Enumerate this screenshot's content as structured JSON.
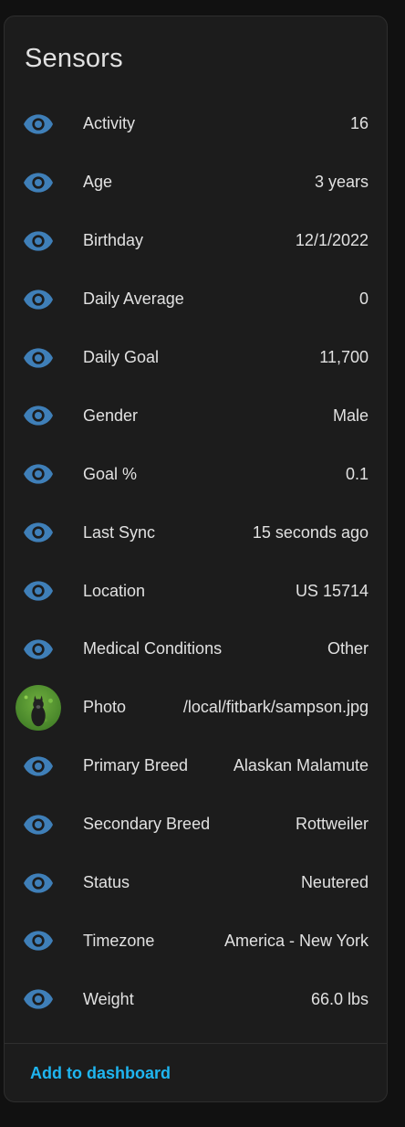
{
  "card": {
    "title": "Sensors",
    "footer_action": "Add to dashboard"
  },
  "colors": {
    "background": "#111111",
    "card": "#1c1c1c",
    "text": "#e1e1e1",
    "icon": "#3f7fb8",
    "accent": "#1fb5f0"
  },
  "sensors": [
    {
      "label": "Activity",
      "value": "16",
      "icon": "eye-icon"
    },
    {
      "label": "Age",
      "value": "3 years",
      "icon": "eye-icon"
    },
    {
      "label": "Birthday",
      "value": "12/1/2022",
      "icon": "eye-icon"
    },
    {
      "label": "Daily Average",
      "value": "0",
      "icon": "eye-icon"
    },
    {
      "label": "Daily Goal",
      "value": "11,700",
      "icon": "eye-icon"
    },
    {
      "label": "Gender",
      "value": "Male",
      "icon": "eye-icon"
    },
    {
      "label": "Goal %",
      "value": "0.1",
      "icon": "eye-icon"
    },
    {
      "label": "Last Sync",
      "value": "15 seconds ago",
      "icon": "eye-icon"
    },
    {
      "label": "Location",
      "value": "US 15714",
      "icon": "eye-icon"
    },
    {
      "label": "Medical Conditions",
      "value": "Other",
      "icon": "eye-icon"
    },
    {
      "label": "Photo",
      "value": "/local/fitbark/sampson.jpg",
      "icon": "dog-photo-avatar"
    },
    {
      "label": "Primary Breed",
      "value": "Alaskan Malamute",
      "icon": "eye-icon"
    },
    {
      "label": "Secondary Breed",
      "value": "Rottweiler",
      "icon": "eye-icon"
    },
    {
      "label": "Status",
      "value": "Neutered",
      "icon": "eye-icon"
    },
    {
      "label": "Timezone",
      "value": "America - New York",
      "icon": "eye-icon"
    },
    {
      "label": "Weight",
      "value": "66.0 lbs",
      "icon": "eye-icon"
    }
  ]
}
